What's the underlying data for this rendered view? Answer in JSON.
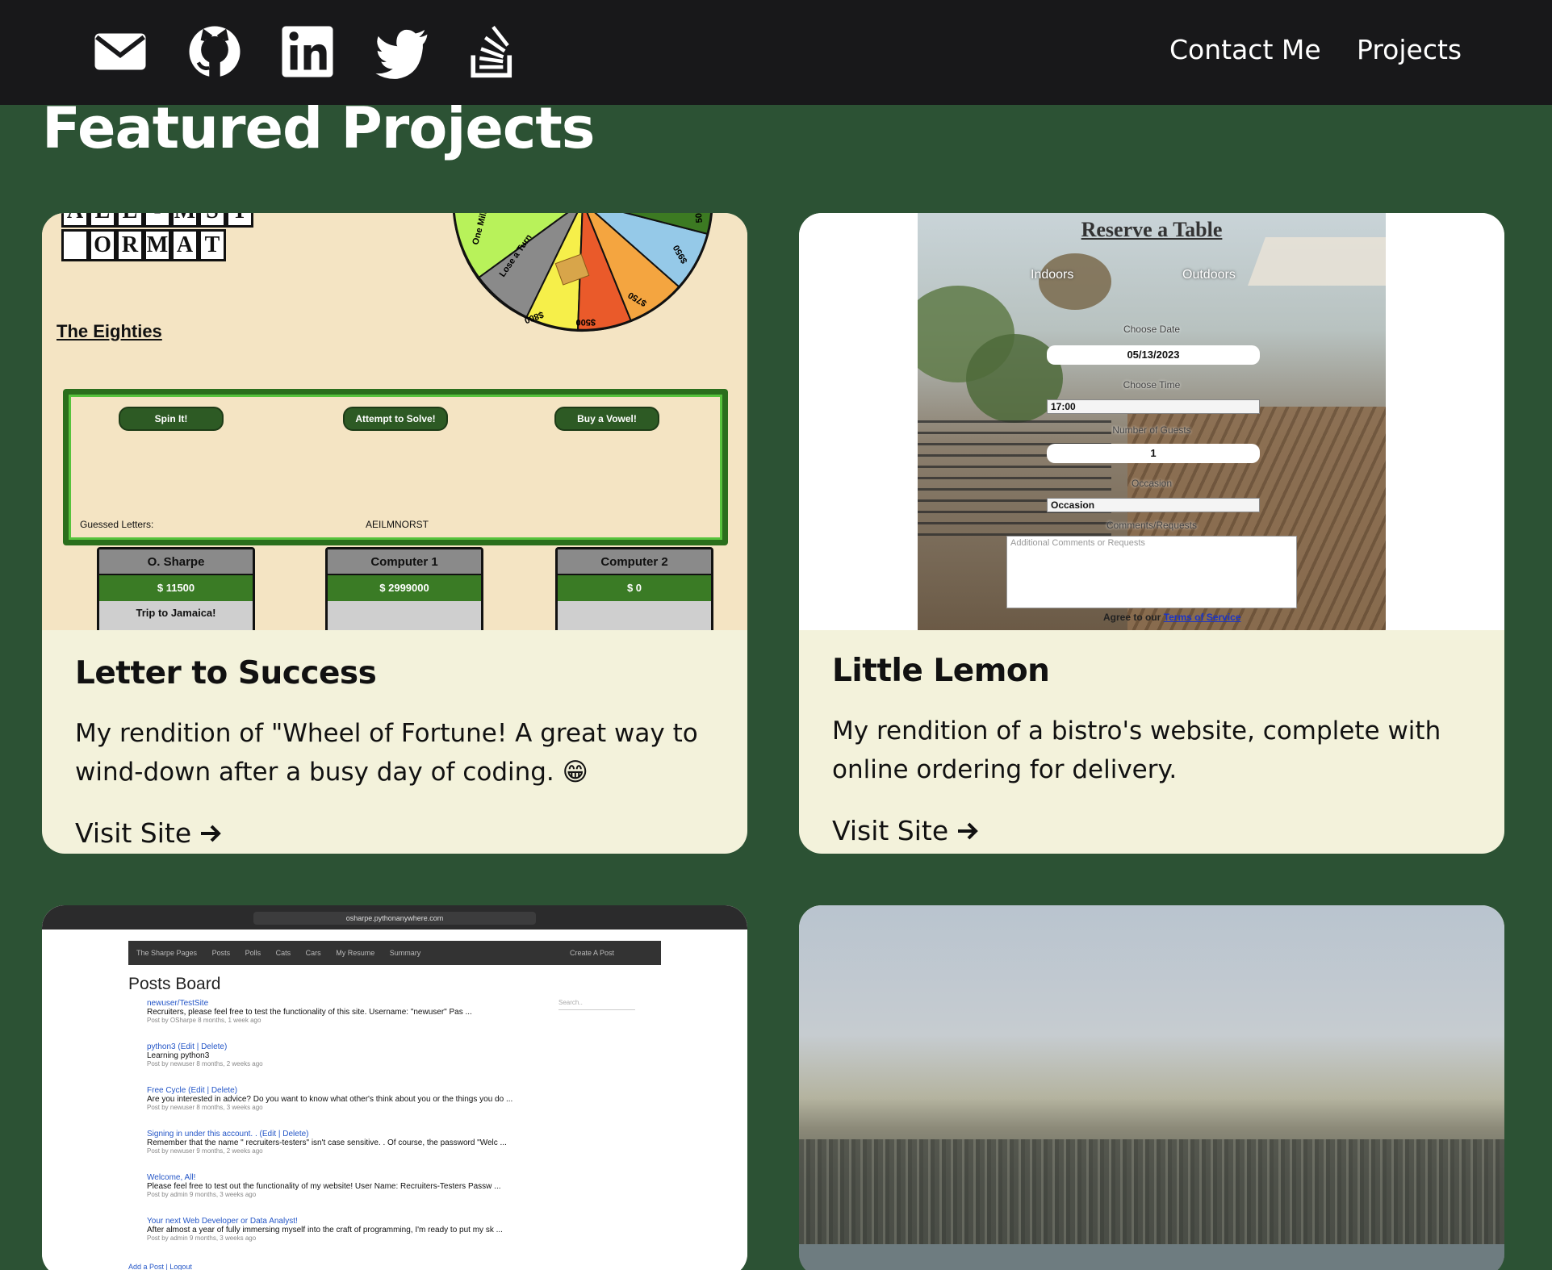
{
  "nav": {
    "social_icons": [
      "envelope-icon",
      "github-icon",
      "linkedin-icon",
      "twitter-icon",
      "stackoverflow-icon"
    ],
    "links": [
      {
        "label": "Contact Me"
      },
      {
        "label": "Projects"
      }
    ]
  },
  "page": {
    "title": "Featured Projects"
  },
  "colors": {
    "background": "#2c5234",
    "nav": "#18181a",
    "card": "#f3f2db"
  },
  "projects": [
    {
      "title": "Letter to Success",
      "description": "My rendition of \"Wheel of Fortune! A great way to wind-down after a busy day of coding. 😁",
      "link_label": "Visit Site",
      "screenshot": {
        "puzzle_rows": [
          [
            "A",
            "L",
            "L",
            "-",
            "M",
            "S",
            "T"
          ],
          [
            "O",
            "R",
            "M",
            "A",
            "T"
          ]
        ],
        "category": "The Eighties",
        "buttons": [
          "Spin It!",
          "Attempt to Solve!",
          "Buy a Vowel!"
        ],
        "guessed_label": "Guessed Letters:",
        "guessed_value": "AEILMNORST",
        "wheel_labels": [
          "One Million",
          "Lose a Turn",
          "$800",
          "$500",
          "$750",
          "$950",
          "500"
        ],
        "players": [
          {
            "name": "O. Sharpe",
            "score": "$ 11500",
            "prize": "Trip to Jamaica!"
          },
          {
            "name": "Computer 1",
            "score": "$ 2999000",
            "prize": ""
          },
          {
            "name": "Computer 2",
            "score": "$ 0",
            "prize": ""
          }
        ]
      }
    },
    {
      "title": "Little Lemon",
      "description": "My rendition of a bistro's website, complete with online ordering for delivery.",
      "link_label": "Visit Site",
      "screenshot": {
        "heading": "Reserve a Table",
        "seating": [
          "Indoors",
          "Outdoors"
        ],
        "date_label": "Choose Date",
        "date_value": "05/13/2023",
        "time_label": "Choose Time",
        "time_value": "17:00",
        "guests_label": "Number of Guests",
        "guests_value": "1",
        "occasion_label": "Occasion",
        "occasion_value": "Occasion",
        "comments_label": "Comments/Requests",
        "comments_placeholder": "Additional Comments or Requests",
        "agree_text": "Agree to our",
        "terms_link": "Terms of Service"
      }
    },
    {
      "title": "",
      "screenshot": {
        "url": "osharpe.pythonanywhere.com",
        "nav_items": [
          "The Sharpe Pages",
          "Posts",
          "Polls",
          "Cats",
          "Cars",
          "My Resume",
          "Summary"
        ],
        "create_post": "Create A Post",
        "heading": "Posts Board",
        "search_placeholder": "Search..",
        "posts": [
          {
            "title": "newuser/TestSite",
            "text": "Recruiters, please feel free to test the functionality of this site. Username: \"newuser\" Pas ...",
            "meta": "Post by OSharpe 8 months, 1 week ago"
          },
          {
            "title": "python3 (Edit | Delete)",
            "text": "Learning python3",
            "meta": "Post by newuser 8 months, 2 weeks ago"
          },
          {
            "title": "Free Cycle (Edit | Delete)",
            "text": "Are you interested in advice? Do you want to know what other's think about you or the things you do ...",
            "meta": "Post by newuser 8 months, 3 weeks ago"
          },
          {
            "title": "Signing in under this account. . (Edit | Delete)",
            "text": "Remember that the name \" recruiters-testers\" isn't case sensitive. . Of course, the password \"Welc ...",
            "meta": "Post by newuser 9 months, 2 weeks ago"
          },
          {
            "title": "Welcome, All!",
            "text": "Please feel free to test out the functionality of my website! User Name: Recruiters-Testers Passw ...",
            "meta": "Post by admin 9 months, 3 weeks ago"
          },
          {
            "title": "Your next Web Developer or Data Analyst!",
            "text": "After almost a year of fully immersing myself into the craft of programming, I'm ready to put my sk ...",
            "meta": "Post by admin 9 months, 3 weeks ago"
          }
        ],
        "footer_links": "Add a Post | Logout"
      }
    },
    {
      "title": "",
      "screenshot": {
        "subject": "aerial-city-photo"
      }
    }
  ]
}
